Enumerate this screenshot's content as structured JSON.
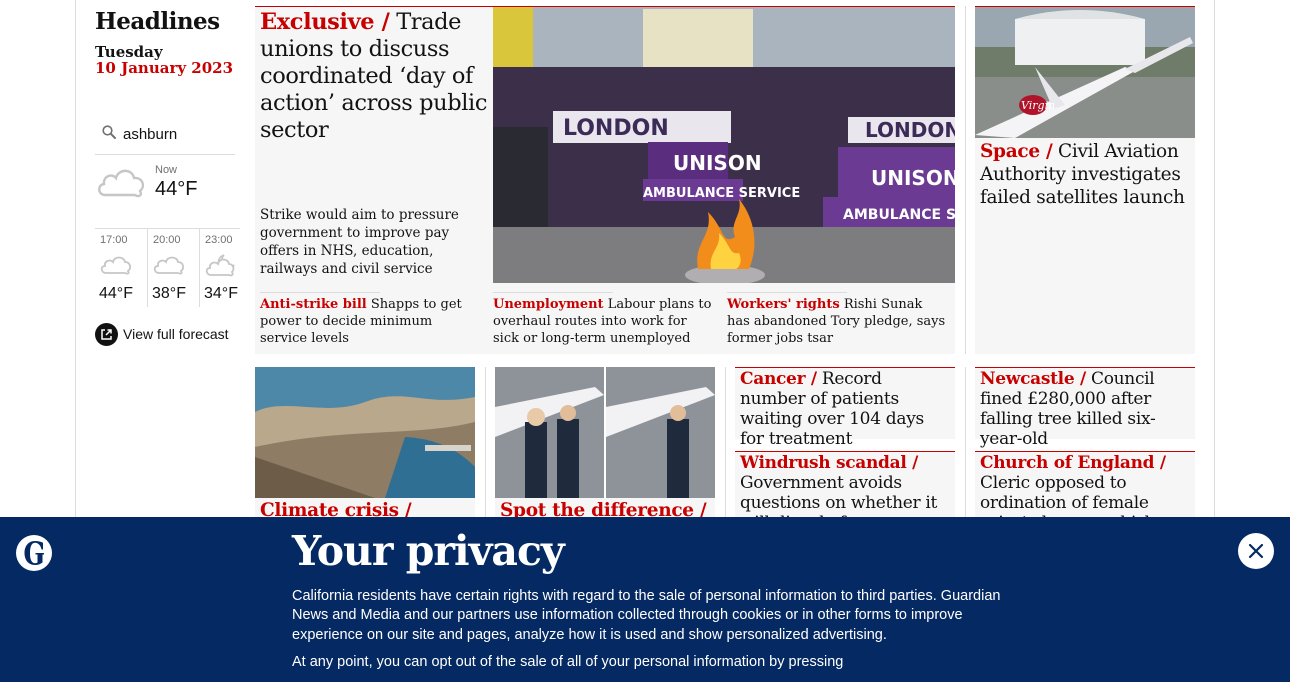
{
  "sidebar": {
    "title": "Headlines",
    "day": "Tuesday",
    "date": "10 January 2023",
    "search": {
      "value": "ashburn"
    },
    "weather": {
      "now_label": "Now",
      "now_temp": "44°F",
      "now_icon": "cloud-icon",
      "forecast": [
        {
          "time": "17:00",
          "temp": "44°F",
          "icon": "cloud-icon"
        },
        {
          "time": "20:00",
          "temp": "38°F",
          "icon": "cloud-icon"
        },
        {
          "time": "23:00",
          "temp": "34°F",
          "icon": "cloud-moon-icon"
        }
      ],
      "link_label": "View full forecast"
    }
  },
  "lead": {
    "kicker": "Exclusive /",
    "headline": "Trade unions to discuss coordinated ‘day of action’ across public sector",
    "standfirst": "Strike would aim to pressure government to improve pay offers in NHS, education, railways and civil service",
    "image_signs": [
      "LONDON",
      "UNISON",
      "AMBULANCE SERVICE",
      "UNISON",
      "LONDON",
      "UNISON",
      "AMBULANCE SER"
    ],
    "sublinks": [
      {
        "kicker": "Anti-strike bill",
        "text": "Shapps to get power to decide minimum service levels"
      },
      {
        "kicker": "Unemployment",
        "text": "Labour plans to overhaul routes into work for sick or long-term unemployed"
      },
      {
        "kicker": "Workers' rights",
        "text": "Rishi Sunak has abandoned Tory pledge, says former jobs tsar"
      }
    ]
  },
  "space": {
    "kicker": "Space /",
    "headline": "Civil Aviation Authority investigates failed satellites launch",
    "image_text": "Virgin"
  },
  "row2": {
    "climate": {
      "kicker": "Climate crisis /"
    },
    "spot": {
      "kicker": "Spot the difference /"
    },
    "cancer": {
      "kicker": "Cancer /",
      "headline": "Record number of patients waiting over 104 days for treatment"
    },
    "windrush": {
      "kicker": "Windrush scandal /",
      "headline": "Government avoids questions on whether it will dispel of"
    },
    "newcastle": {
      "kicker": "Newcastle /",
      "headline": "Council fined £280,000 after falling tree killed six-year-old"
    },
    "church": {
      "kicker": "Church of England /",
      "headline": "Cleric opposed to ordination of female priests becomes bishop of Blackburn"
    }
  },
  "privacy": {
    "logo_icon": "guardian-g-logo-icon",
    "title": "Your privacy",
    "body_1": "California residents have certain rights with regard to the sale of personal information to third parties. Guardian News and Media and our partners use information collected through cookies or in other forms to improve experience on our site and pages, analyze how it is used and show personalized advertising.",
    "body_2": "At any point, you can opt out of the sale of all of your personal information by pressing",
    "close_icon": "close-icon"
  },
  "colors": {
    "accent_red": "#c70000",
    "banner_blue": "#052962",
    "card_bg": "#f6f6f6"
  }
}
